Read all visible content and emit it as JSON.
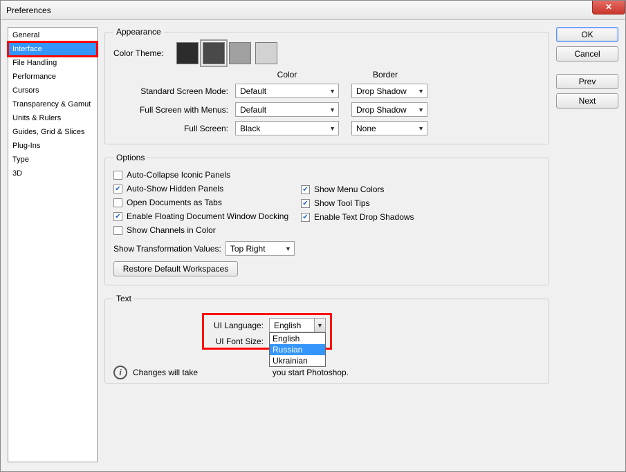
{
  "window": {
    "title": "Preferences",
    "close_glyph": "✕"
  },
  "buttons": {
    "ok": "OK",
    "cancel": "Cancel",
    "prev": "Prev",
    "next": "Next"
  },
  "sidebar": {
    "items": [
      "General",
      "Interface",
      "File Handling",
      "Performance",
      "Cursors",
      "Transparency & Gamut",
      "Units & Rulers",
      "Guides, Grid & Slices",
      "Plug-Ins",
      "Type",
      "3D"
    ],
    "selected_index": 1
  },
  "appearance": {
    "legend": "Appearance",
    "color_theme_label": "Color Theme:",
    "swatches": [
      "#2c2c2c",
      "#494949",
      "#a0a0a0",
      "#d2d2d2"
    ],
    "swatch_selected": 1,
    "headers": {
      "color": "Color",
      "border": "Border"
    },
    "rows": [
      {
        "label": "Standard Screen Mode:",
        "color": "Default",
        "border": "Drop Shadow"
      },
      {
        "label": "Full Screen with Menus:",
        "color": "Default",
        "border": "Drop Shadow"
      },
      {
        "label": "Full Screen:",
        "color": "Black",
        "border": "None"
      }
    ]
  },
  "options": {
    "legend": "Options",
    "left": [
      {
        "label": "Auto-Collapse Iconic Panels",
        "checked": false
      },
      {
        "label": "Auto-Show Hidden Panels",
        "checked": true
      },
      {
        "label": "Open Documents as Tabs",
        "checked": false
      },
      {
        "label": "Enable Floating Document Window Docking",
        "checked": true
      },
      {
        "label": "Show Channels in Color",
        "checked": false
      }
    ],
    "right": [
      {
        "label": "Show Menu Colors",
        "checked": true
      },
      {
        "label": "Show Tool Tips",
        "checked": true
      },
      {
        "label": "Enable Text Drop Shadows",
        "checked": true
      }
    ],
    "trans_label": "Show Transformation Values:",
    "trans_value": "Top Right",
    "restore": "Restore Default Workspaces"
  },
  "text": {
    "legend": "Text",
    "lang_label": "UI Language:",
    "lang_value": "English",
    "lang_options": [
      "English",
      "Russian",
      "Ukrainian"
    ],
    "lang_selected_index": 1,
    "font_label": "UI Font Size:",
    "info_pre": "Changes will take ",
    "info_post": " you start Photoshop."
  }
}
